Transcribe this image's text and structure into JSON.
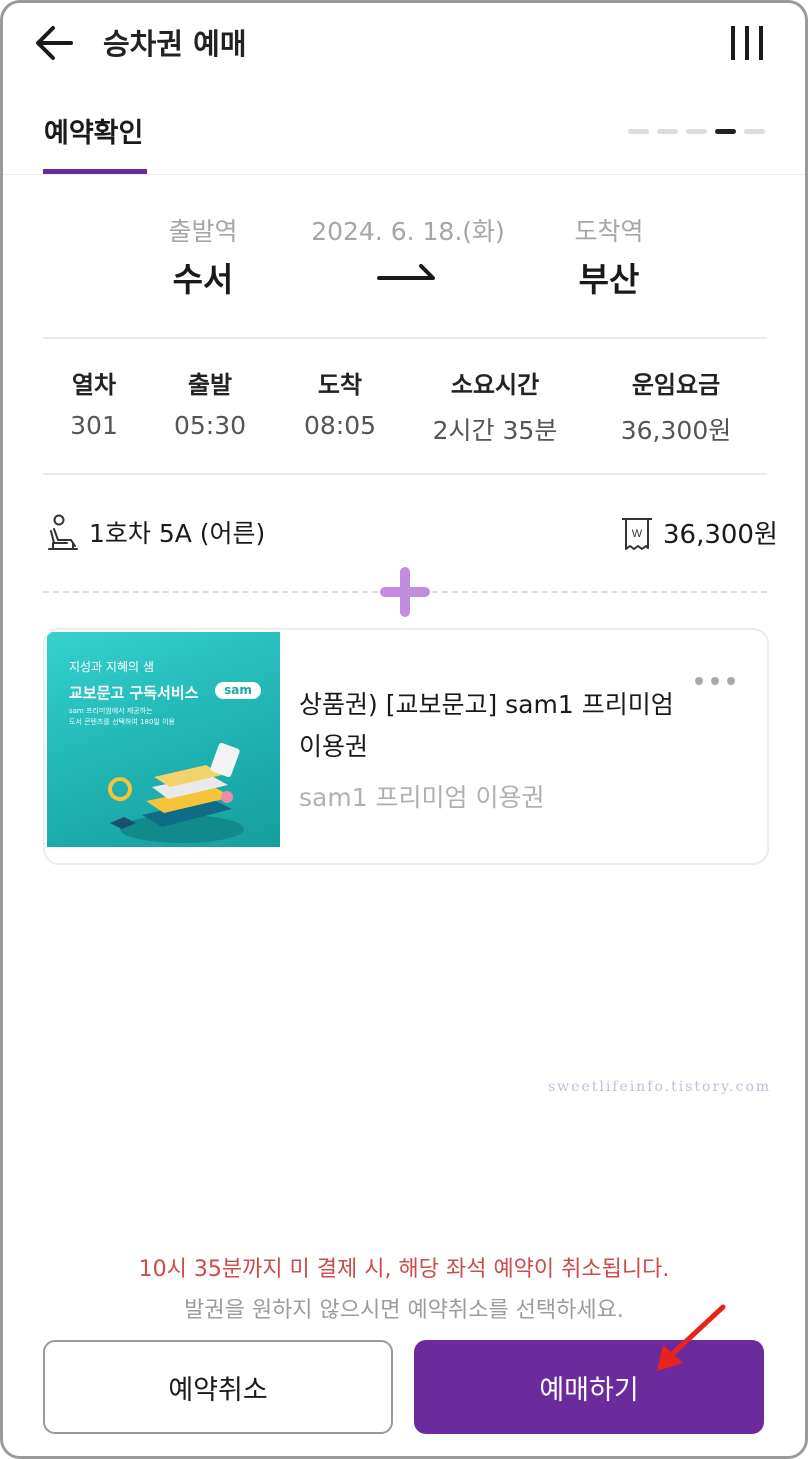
{
  "header": {
    "title": "승차권 예매"
  },
  "steps": {
    "current_label": "예약확인",
    "total": 5,
    "active_index": 3
  },
  "route": {
    "departure_label": "출발역",
    "departure_station": "수서",
    "date": "2024. 6. 18.(화)",
    "arrival_label": "도착역",
    "arrival_station": "부산"
  },
  "train_info": {
    "columns": [
      {
        "label": "열차",
        "value": "301"
      },
      {
        "label": "출발",
        "value": "05:30"
      },
      {
        "label": "도착",
        "value": "08:05"
      },
      {
        "label": "소요시간",
        "value": "2시간 35분"
      },
      {
        "label": "운임요금",
        "value": "36,300원"
      }
    ]
  },
  "seat": {
    "text": "1호차 5A (어른)",
    "price": "36,300원"
  },
  "product": {
    "thumb_line1": "지성과 지혜의 샘",
    "thumb_line2": "교보문고 구독서비스",
    "thumb_logo": "sam",
    "thumb_line3": "sam 프리미엄에서 제공하는",
    "thumb_line4": "도서 콘텐츠를 선택하여 180일 이용",
    "title": "상품권) [교보문고] sam1 프리미엄 이용권",
    "subtitle": "sam1 프리미엄 이용권"
  },
  "watermark": "sweetlifeinfo.tistory.com",
  "footer": {
    "notice": "10시 35분까지 미 결제 시, 해당 좌석 예약이 취소됩니다.",
    "subnotice": "발권을 원하지 않으시면 예약취소를 선택하세요.",
    "cancel_label": "예약취소",
    "pay_label": "예매하기"
  },
  "colors": {
    "brand_purple": "#6b2b9c",
    "plus_purple": "#c28de0",
    "notice_red": "#cc4b4b",
    "annotation_arrow": "#e8231b"
  }
}
